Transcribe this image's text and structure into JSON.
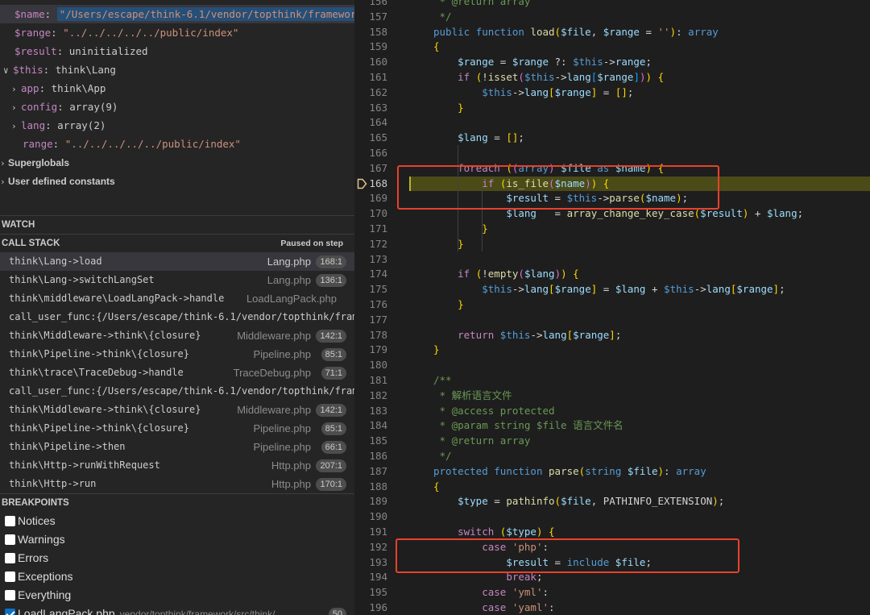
{
  "variables": [
    {
      "name": "$name",
      "value": "\"/Users/escape/think-6.1/vendor/topthink/framework/s…"
    },
    {
      "name": "$range",
      "value": "\"../../../../../public/index\""
    },
    {
      "name": "$result",
      "value": "uninitialized"
    },
    {
      "name": "$this",
      "value": "think\\Lang"
    },
    {
      "name": "app",
      "value": "think\\App"
    },
    {
      "name": "config",
      "value": "array(9)"
    },
    {
      "name": "lang",
      "value": "array(2)"
    },
    {
      "name": "range",
      "value": "\"../../../../../public/index\""
    }
  ],
  "groups": [
    "Superglobals",
    "User defined constants"
  ],
  "watch_title": "WATCH",
  "call_stack_title": "CALL STACK",
  "paused_label": "Paused on step",
  "call_stack": [
    {
      "fn": "think\\Lang->load",
      "file": "Lang.php",
      "line": "168:1"
    },
    {
      "fn": "think\\Lang->switchLangSet",
      "file": "Lang.php",
      "line": "136:1"
    },
    {
      "fn": "think\\middleware\\LoadLangPack->handle",
      "file": "LoadLangPack.php",
      "line": ""
    },
    {
      "fn": "call_user_func:{/Users/escape/think-6.1/vendor/topthink/framew",
      "file": "",
      "line": ""
    },
    {
      "fn": "think\\Middleware->think\\{closure}",
      "file": "Middleware.php",
      "line": "142:1"
    },
    {
      "fn": "think\\Pipeline->think\\{closure}",
      "file": "Pipeline.php",
      "line": "85:1"
    },
    {
      "fn": "think\\trace\\TraceDebug->handle",
      "file": "TraceDebug.php",
      "line": "71:1"
    },
    {
      "fn": "call_user_func:{/Users/escape/think-6.1/vendor/topthink/framew",
      "file": "",
      "line": ""
    },
    {
      "fn": "think\\Middleware->think\\{closure}",
      "file": "Middleware.php",
      "line": "142:1"
    },
    {
      "fn": "think\\Pipeline->think\\{closure}",
      "file": "Pipeline.php",
      "line": "85:1"
    },
    {
      "fn": "think\\Pipeline->then",
      "file": "Pipeline.php",
      "line": "66:1"
    },
    {
      "fn": "think\\Http->runWithRequest",
      "file": "Http.php",
      "line": "207:1"
    },
    {
      "fn": "think\\Http->run",
      "file": "Http.php",
      "line": "170:1"
    }
  ],
  "breakpoints_title": "BREAKPOINTS",
  "breakpoints": [
    {
      "label": "Notices",
      "checked": false
    },
    {
      "label": "Warnings",
      "checked": false
    },
    {
      "label": "Errors",
      "checked": false
    },
    {
      "label": "Exceptions",
      "checked": false
    },
    {
      "label": "Everything",
      "checked": false
    },
    {
      "label": "LoadLangPack.php",
      "path": "vendor/topthink/framework/src/think/...",
      "count": "50",
      "checked": true
    }
  ],
  "editor": {
    "first_line": 156,
    "current_line": 168,
    "accent": "#e8412c",
    "lines": [
      "     * @return array",
      "     */",
      "    public function load($file, $range = ''): array",
      "    {",
      "        $range = $range ?: $this->range;",
      "        if (!isset($this->lang[$range])) {",
      "            $this->lang[$range] = [];",
      "        }",
      "",
      "        $lang = [];",
      "",
      "        foreach ((array) $file as $name) {",
      "            if (is_file($name)) {",
      "                $result = $this->parse($name);",
      "                $lang   = array_change_key_case($result) + $lang;",
      "            }",
      "        }",
      "",
      "        if (!empty($lang)) {",
      "            $this->lang[$range] = $lang + $this->lang[$range];",
      "        }",
      "",
      "        return $this->lang[$range];",
      "    }",
      "",
      "    /**",
      "     * 解析语言文件",
      "     * @access protected",
      "     * @param string $file 语言文件名",
      "     * @return array",
      "     */",
      "    protected function parse(string $file): array",
      "    {",
      "        $type = pathinfo($file, PATHINFO_EXTENSION);",
      "",
      "        switch ($type) {",
      "            case 'php':",
      "                $result = include $file;",
      "                break;",
      "            case 'yml':",
      "            case 'yaml':"
    ]
  }
}
